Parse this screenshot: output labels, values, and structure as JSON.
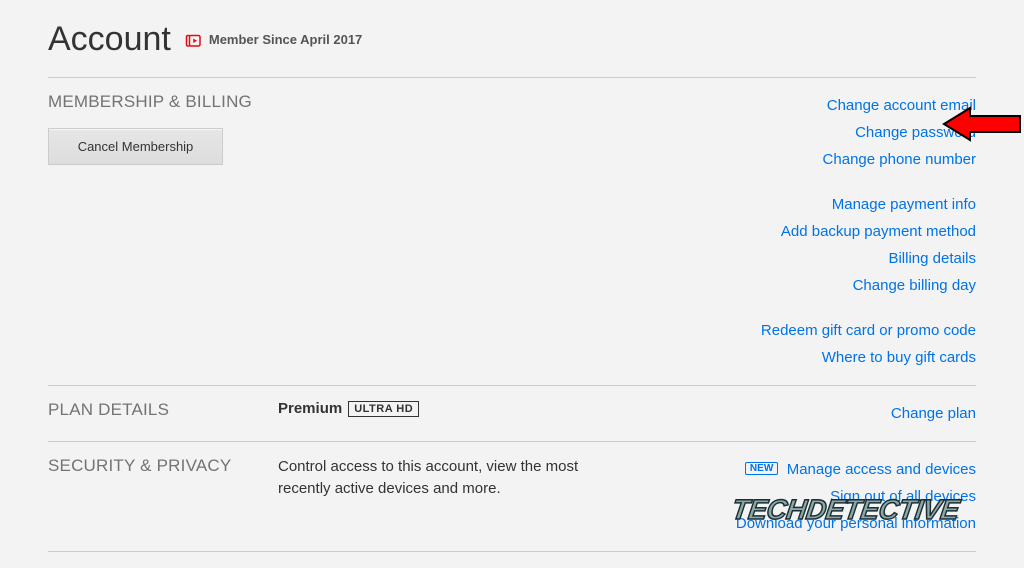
{
  "header": {
    "title": "Account",
    "memberSince": "Member Since April 2017"
  },
  "membership": {
    "heading": "MEMBERSHIP & BILLING",
    "cancelLabel": "Cancel Membership",
    "linksA": {
      "email": "Change account email",
      "password": "Change password",
      "phone": "Change phone number"
    },
    "linksB": {
      "paymentInfo": "Manage payment info",
      "backup": "Add backup payment method",
      "billingDetails": "Billing details",
      "billingDay": "Change billing day"
    },
    "linksC": {
      "redeem": "Redeem gift card or promo code",
      "where": "Where to buy gift cards"
    }
  },
  "plan": {
    "heading": "PLAN DETAILS",
    "name": "Premium",
    "badge": "ULTRA HD",
    "changeLink": "Change plan"
  },
  "security": {
    "heading": "SECURITY & PRIVACY",
    "description": "Control access to this account, view the most recently active devices and more.",
    "newBadge": "NEW",
    "links": {
      "manage": "Manage access and devices",
      "signout": "Sign out of all devices",
      "download": "Download your personal information"
    }
  },
  "watermark": "TECHDETECTIVE"
}
